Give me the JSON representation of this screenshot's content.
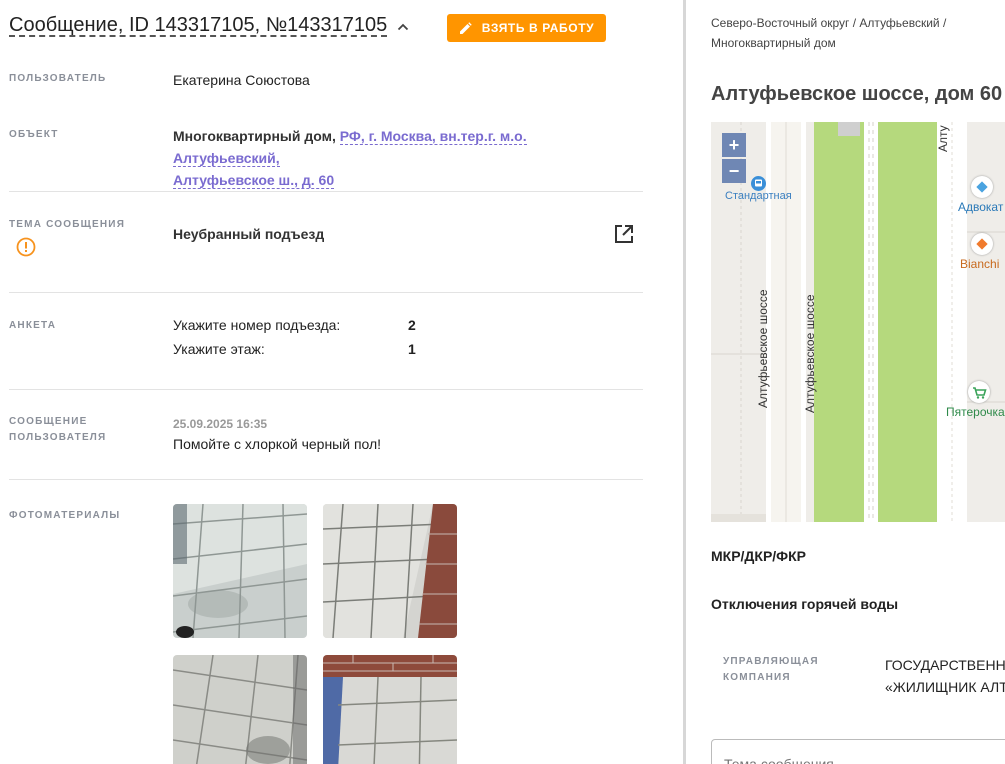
{
  "header": {
    "title": "Сообщение, ID 143317105, №143317105",
    "take_button": "ВЗЯТЬ В РАБОТУ"
  },
  "fields": {
    "user": {
      "label": "ПОЛЬЗОВАТЕЛЬ",
      "value": "Екатерина Союстова"
    },
    "object": {
      "label": "ОБЪЕКТ",
      "type": "Многоквартирный дом,",
      "address_line1": "РФ, г. Москва, вн.тер.г. м.о. Алтуфьевский,",
      "address_line2": "Алтуфьевское ш., д. 60"
    },
    "topic": {
      "label": "ТЕМА СООБЩЕНИЯ",
      "value": "Неубранный подъезд"
    },
    "anketa": {
      "label": "АНКЕТА",
      "items": [
        {
          "q": "Укажите номер подъезда:",
          "a": "2"
        },
        {
          "q": "Укажите этаж:",
          "a": "1"
        }
      ]
    },
    "user_message": {
      "label_line1": "СООБЩЕНИЕ",
      "label_line2": "ПОЛЬЗОВАТЕЛЯ",
      "date": "25.09.2025 16:35",
      "text": "Помойте с хлоркой черный пол!"
    },
    "photos": {
      "label": "ФОТОМАТЕРИАЛЫ"
    }
  },
  "right": {
    "breadcrumb_line1": "Северо-Восточный округ / Алтуфьевский /",
    "breadcrumb_line2": "Многоквартирный дом",
    "address": "Алтуфьевское шоссе, дом 60",
    "map": {
      "zoom_in": "+",
      "zoom_out": "−",
      "stop_label": "Стандартная",
      "street_label_1": "Алтуфьевское шоссе",
      "street_label_2": "Алтуфьевское шоссе",
      "street_label_top": "Алту",
      "poi_1": "Адвокат",
      "poi_2": "Bianchi",
      "poi_3": "Пятерочка"
    },
    "mkr": "МКР/ДКР/ФКР",
    "hot_water": "Отключения горячей воды",
    "management": {
      "label_line1": "УПРАВЛЯЮЩАЯ",
      "label_line2": "КОМПАНИЯ",
      "value_line1": "ГОСУДАРСТВЕННОЕ",
      "value_line2": "«ЖИЛИЩНИК АЛТУ"
    },
    "topic_placeholder": "Тема сообщения"
  },
  "colors": {
    "accent_orange": "#ff9500",
    "link_purple": "#7a6bd0",
    "map_green": "#b5d97d",
    "zoom_blue": "#6f87b4"
  }
}
